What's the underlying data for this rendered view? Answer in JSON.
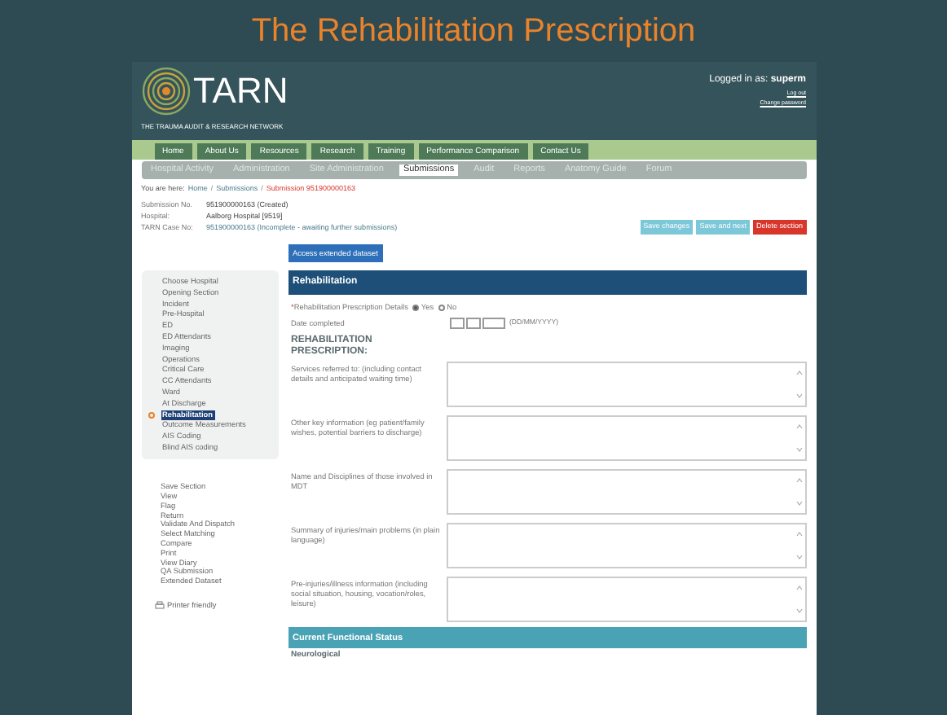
{
  "slide_title": "The Rehabilitation Prescription",
  "header": {
    "logo_text": "TARN",
    "tagline": "THE TRAUMA AUDIT & RESEARCH NETWORK",
    "logged_in_label": "Logged in as:",
    "user": "superm",
    "links": [
      "Log out",
      "Change password"
    ]
  },
  "main_nav": [
    "Home",
    "About Us",
    "Resources",
    "Research",
    "Training",
    "Performance Comparison",
    "Contact Us"
  ],
  "sub_nav": [
    {
      "label": "Hospital Activity",
      "selected": false
    },
    {
      "label": "Administration",
      "selected": false
    },
    {
      "label": "Site Administration",
      "selected": false
    },
    {
      "label": "Submissions",
      "selected": true
    },
    {
      "label": "Audit",
      "selected": false
    },
    {
      "label": "Reports",
      "selected": false
    },
    {
      "label": "Anatomy Guide",
      "selected": false
    },
    {
      "label": "Forum",
      "selected": false
    }
  ],
  "breadcrumb": {
    "label": "You are here:",
    "links": [
      "Home",
      "Submissions"
    ],
    "separator": "/",
    "current": "Submission 951900000163"
  },
  "info": [
    {
      "label": "Submission No.",
      "value": "951900000163 (Created)",
      "kind": "plain"
    },
    {
      "label": "Hospital:",
      "value": "Aalborg Hospital [9519]",
      "kind": "plain"
    },
    {
      "label": "TARN Case No:",
      "value": "951900000163 (Incomplete - awaiting further submissions)",
      "kind": "muted"
    }
  ],
  "actions": [
    {
      "label": "Save changes",
      "kind": "secondary"
    },
    {
      "label": "Save and next",
      "kind": "secondary"
    },
    {
      "label": "Delete section",
      "kind": "danger"
    }
  ],
  "extended_button": "Access extended dataset",
  "sidebar": {
    "items": [
      {
        "label": "Choose Hospital",
        "selected": false
      },
      {
        "label": "Opening Section",
        "selected": false
      },
      {
        "label": "Incident",
        "selected": false
      },
      {
        "label": "Pre-Hospital",
        "selected": false
      },
      {
        "label": "ED",
        "selected": false
      },
      {
        "label": "ED Attendants",
        "selected": false
      },
      {
        "label": "Imaging",
        "selected": false
      },
      {
        "label": "Operations",
        "selected": false
      },
      {
        "label": "Critical Care",
        "selected": false
      },
      {
        "label": "CC Attendants",
        "selected": false
      },
      {
        "label": "Ward",
        "selected": false
      },
      {
        "label": "At Discharge",
        "selected": false
      },
      {
        "label": "Rehabilitation",
        "selected": true
      },
      {
        "label": "Outcome Measurements",
        "selected": false
      },
      {
        "label": "AIS Coding",
        "selected": false
      },
      {
        "label": "Blind AIS coding",
        "selected": false
      }
    ],
    "tools": [
      "Save Section",
      "View",
      "Flag",
      "Return",
      "Validate And Dispatch",
      "Select Matching",
      "Compare",
      "Print",
      "View Diary",
      "QA Submission",
      "Extended Dataset"
    ],
    "printer_link": "Printer friendly"
  },
  "form": {
    "section_title": "Rehabilitation",
    "question": {
      "required_mark": "*",
      "label": "Rehabilitation Prescription Details",
      "options": [
        {
          "label": "Yes",
          "selected": true
        },
        {
          "label": "No",
          "selected": false
        }
      ]
    },
    "date": {
      "label": "Date completed",
      "hint": "(DD/MM/YYYY)"
    },
    "subheading": "REHABILITATION PRESCRIPTION:",
    "text_fields": [
      "Services referred to: (including contact details and anticipated waiting time)",
      "Other key information (eg patient/family wishes, potential barriers to discharge)",
      "Name and Disciplines of those involved in MDT",
      "Summary of injuries/main problems (in plain language)",
      "Pre-injuries/illness information (including social situation, housing, vocation/roles, leisure)"
    ],
    "next_section": "Current Functional Status",
    "next_subheading": "Neurological"
  }
}
